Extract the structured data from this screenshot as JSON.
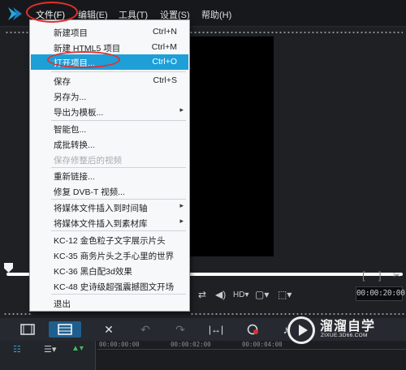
{
  "menubar": {
    "items": [
      {
        "label": "文件(F)",
        "active": true
      },
      {
        "label": "编辑(E)"
      },
      {
        "label": "工具(T)"
      },
      {
        "label": "设置(S)"
      },
      {
        "label": "帮助(H)"
      }
    ]
  },
  "file_menu": {
    "items": [
      {
        "label": "新建项目",
        "shortcut": "Ctrl+N"
      },
      {
        "label": "新建 HTML5 项目",
        "shortcut": "Ctrl+M"
      },
      {
        "label": "打开项目...",
        "shortcut": "Ctrl+O",
        "highlighted": true
      },
      {
        "label": "保存",
        "shortcut": "Ctrl+S"
      },
      {
        "label": "另存为..."
      },
      {
        "label": "导出为模板...",
        "submenu": true
      },
      {
        "label": "智能包..."
      },
      {
        "label": "成批转换..."
      },
      {
        "label": "保存修整后的视频",
        "disabled": true
      },
      {
        "label": "重新链接..."
      },
      {
        "label": "修复 DVB-T 视频..."
      },
      {
        "label": "将媒体文件插入到时间轴",
        "submenu": true
      },
      {
        "label": "将媒体文件插入到素材库",
        "submenu": true
      },
      {
        "label": "KC-12 金色粒子文字展示片头"
      },
      {
        "label": "KC-35 商务片头之手心里的世界"
      },
      {
        "label": "KC-36 黑白配3d效果"
      },
      {
        "label": "KC-48 史诗级超强震撼图文开场"
      },
      {
        "label": "退出"
      }
    ],
    "submenu_arrow": "▸"
  },
  "player": {
    "timecode": "00:00:20:00",
    "trim_in": "[",
    "trim_out": "]"
  },
  "timeline": {
    "ruler_ticks": [
      "00:00:00:00",
      "00:00:02:00",
      "00:00:04:00"
    ]
  },
  "watermark": {
    "title": "溜溜自学",
    "url": "ZIXUE.3D66.COM"
  },
  "colors": {
    "accent": "#1e9fd8",
    "annotation": "#e0312f",
    "logo": "#2aa7e0"
  },
  "icons": {
    "logo": "corel-logo-icon",
    "storyboard": "storyboard-icon",
    "timeline": "timeline-icon",
    "tools": "tools-icon",
    "undo": "undo-icon",
    "redo": "redo-icon",
    "fit": "fit-project-icon",
    "record": "record-icon",
    "music": "music-icon"
  }
}
